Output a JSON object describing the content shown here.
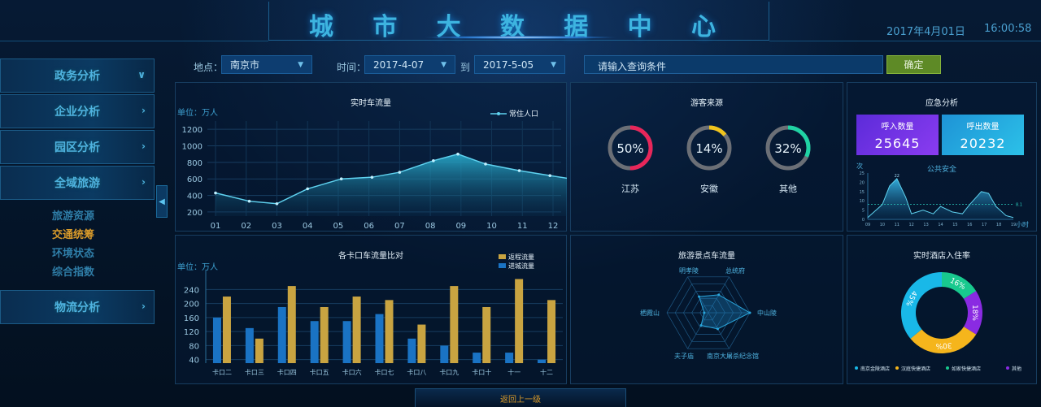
{
  "header": {
    "title_chars": [
      "城",
      "市",
      "大",
      "数",
      "据",
      "中",
      "心"
    ],
    "date": "2017年4月01日",
    "time": "16:00:58"
  },
  "sidebar": {
    "items": [
      {
        "label": "政务分析",
        "arrow": "∨"
      },
      {
        "label": "企业分析",
        "arrow": "›"
      },
      {
        "label": "园区分析",
        "arrow": "›"
      },
      {
        "label": "全域旅游",
        "arrow": "›"
      },
      {
        "label": "物流分析",
        "arrow": "›"
      }
    ],
    "sub_items": [
      {
        "label": "旅游资源",
        "active": false
      },
      {
        "label": "交通统筹",
        "active": true
      },
      {
        "label": "环境状态",
        "active": false
      },
      {
        "label": "综合指数",
        "active": false
      }
    ],
    "collapse_glyph": "◀"
  },
  "filters": {
    "location_label": "地点：",
    "location_value": "南京市",
    "time_label": "时间：",
    "start_date": "2017-4-07",
    "to_label": "到",
    "end_date": "2017-5-05",
    "query_placeholder": "请输入查询条件",
    "confirm_label": "确定",
    "caret": "▼"
  },
  "traffic_flow": {
    "title": "实时车流量",
    "unit": "单位：万人",
    "legend": "常住人口"
  },
  "tourist_source": {
    "title": "游客来源",
    "items": [
      {
        "pct": "50%",
        "label": "江苏",
        "color": "#e8265a"
      },
      {
        "pct": "14%",
        "label": "安徽",
        "color": "#f0c41c"
      },
      {
        "pct": "32%",
        "label": "其他",
        "color": "#1fd3a4"
      }
    ]
  },
  "emergency": {
    "title": "应急分析",
    "inbound_label": "呼入数量",
    "inbound_value": "25645",
    "outbound_label": "呼出数量",
    "outbound_value": "20232",
    "sub_title": "公共安全",
    "y_unit": "次",
    "x_unit": "小时",
    "peak_label": "22",
    "avg_label": "8.1"
  },
  "checkpoint": {
    "title": "各卡口车流量比对",
    "unit": "单位：万人",
    "legend_out": "返程流量",
    "legend_in": "进城流量"
  },
  "scenic_flow": {
    "title": "旅游景点车流量",
    "axes": [
      "明孝陵",
      "总统府",
      "中山陵",
      "南京大屠杀纪念馆",
      "夫子庙",
      "栖霞山"
    ]
  },
  "hotel": {
    "title": "实时酒店入住率",
    "legend": [
      {
        "label": "南京金陵酒店",
        "color": "#19b8e8"
      },
      {
        "label": "汉庭快捷酒店",
        "color": "#f5b51c"
      },
      {
        "label": "如家快捷酒店",
        "color": "#18c98e"
      },
      {
        "label": "其他",
        "color": "#8a2be2"
      }
    ]
  },
  "footer": {
    "back_label": "返回上一级"
  },
  "chart_data": [
    {
      "type": "area",
      "title": "实时车流量",
      "ylabel": "单位：万人",
      "x": [
        "01",
        "02",
        "03",
        "04",
        "05",
        "06",
        "07",
        "08",
        "09",
        "10",
        "11",
        "12"
      ],
      "y_ticks": [
        200,
        400,
        600,
        800,
        1000,
        1200
      ],
      "ylim": [
        150,
        1300
      ],
      "series": [
        {
          "name": "常住人口",
          "points": [
            [
              0.0,
              430
            ],
            [
              1.1,
              330
            ],
            [
              2.0,
              300
            ],
            [
              3.0,
              480
            ],
            [
              4.1,
              600
            ],
            [
              5.1,
              620
            ],
            [
              6.0,
              680
            ],
            [
              7.1,
              820
            ],
            [
              7.9,
              900
            ],
            [
              8.8,
              780
            ],
            [
              9.9,
              700
            ],
            [
              10.9,
              640
            ],
            [
              11.6,
              600
            ]
          ]
        }
      ]
    },
    {
      "type": "pie",
      "title": "游客来源",
      "slices": [
        {
          "label": "江苏",
          "value": 50
        },
        {
          "label": "安徽",
          "value": 14
        },
        {
          "label": "其他",
          "value": 32
        }
      ]
    },
    {
      "type": "area",
      "title": "公共安全",
      "x_ticks": [
        "09",
        "10",
        "11",
        "12",
        "13",
        "14",
        "15",
        "16",
        "17",
        "18",
        "19"
      ],
      "y_ticks": [
        0,
        5,
        10,
        15,
        20,
        25
      ],
      "ylim": [
        0,
        25
      ],
      "points": [
        [
          9,
          1
        ],
        [
          10,
          8
        ],
        [
          10.5,
          18
        ],
        [
          11,
          22
        ],
        [
          11.6,
          12
        ],
        [
          12,
          3
        ],
        [
          12.8,
          5
        ],
        [
          13.5,
          3
        ],
        [
          14,
          7
        ],
        [
          14.8,
          4
        ],
        [
          15.5,
          3
        ],
        [
          16,
          8
        ],
        [
          16.8,
          15
        ],
        [
          17.3,
          14
        ],
        [
          17.8,
          7
        ],
        [
          18.5,
          2
        ],
        [
          19,
          1
        ]
      ],
      "reference_line": 8.1
    },
    {
      "type": "bar",
      "title": "各卡口车流量比对",
      "categories": [
        "卡口二",
        "卡口三",
        "卡口四",
        "卡口五",
        "卡口六",
        "卡口七",
        "卡口八",
        "卡口九",
        "卡口十",
        "十一",
        "十二"
      ],
      "y_ticks": [
        40,
        80,
        120,
        160,
        200,
        240
      ],
      "ylim": [
        30,
        285
      ],
      "series": [
        {
          "name": "进城流量",
          "color": "#1a73c4",
          "values": [
            160,
            130,
            190,
            150,
            150,
            170,
            100,
            80,
            60,
            60,
            40
          ]
        },
        {
          "name": "返程流量",
          "color": "#c9a441",
          "values": [
            220,
            100,
            250,
            190,
            220,
            210,
            140,
            250,
            190,
            270,
            210
          ]
        }
      ]
    },
    {
      "type": "radar",
      "title": "旅游景点车流量",
      "axes": [
        "明孝陵",
        "总统府",
        "中山陵",
        "南京大屠杀纪念馆",
        "夫子庙",
        "栖霞山"
      ],
      "values": [
        0.45,
        0.5,
        1.0,
        0.45,
        0.35,
        0.1
      ]
    },
    {
      "type": "pie",
      "title": "实时酒店入住率",
      "slices": [
        {
          "label": "南京金陵酒店",
          "value": 36
        },
        {
          "label": "汉庭快捷酒店",
          "value": 30
        },
        {
          "label": "如家快捷酒店",
          "value": 16
        },
        {
          "label": "其他",
          "value": 18
        }
      ],
      "slice_labels": [
        "16%",
        "18%",
        "30%",
        "45%"
      ]
    }
  ]
}
